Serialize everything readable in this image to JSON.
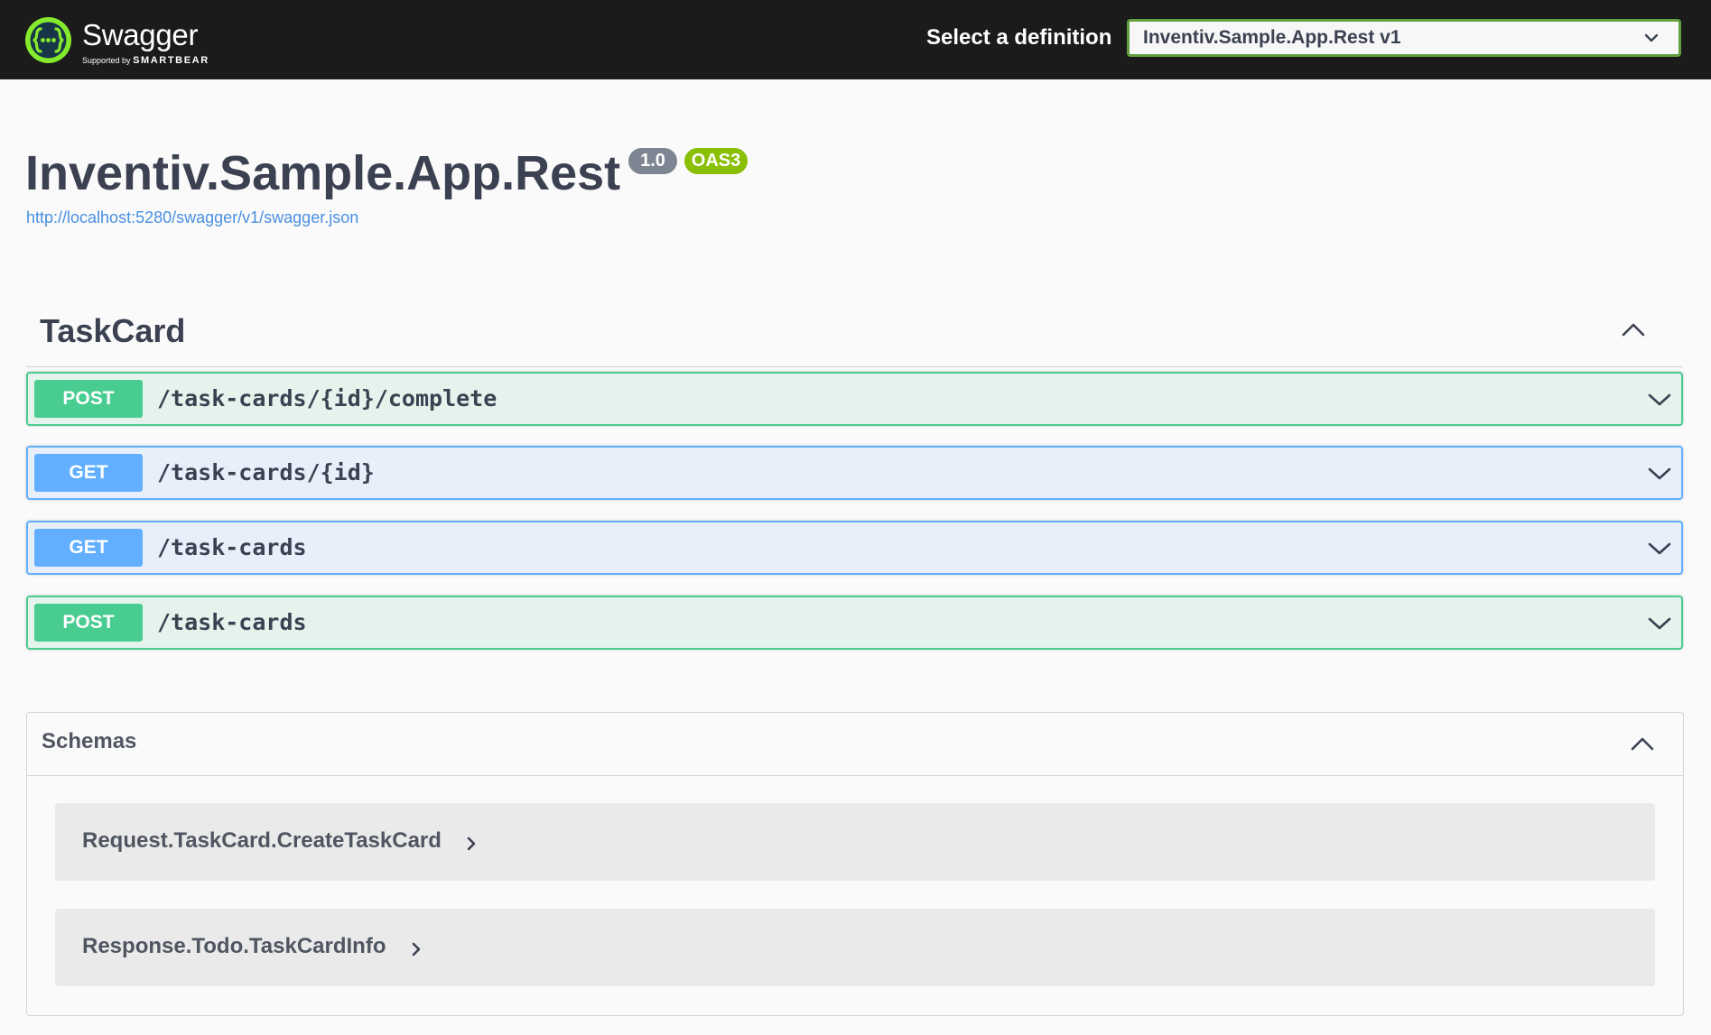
{
  "topbar": {
    "logo_name": "Swagger",
    "logo_sub_prefix": "Supported by",
    "logo_sub_brand": "SMARTBEAR",
    "definition_label": "Select a definition",
    "definition_value": "Inventiv.Sample.App.Rest v1"
  },
  "info": {
    "title": "Inventiv.Sample.App.Rest",
    "version": "1.0",
    "oas_badge": "OAS3",
    "spec_url": "http://localhost:5280/swagger/v1/swagger.json"
  },
  "tag": {
    "name": "TaskCard",
    "operations": [
      {
        "method": "POST",
        "path": "/task-cards/{id}/complete"
      },
      {
        "method": "GET",
        "path": "/task-cards/{id}"
      },
      {
        "method": "GET",
        "path": "/task-cards"
      },
      {
        "method": "POST",
        "path": "/task-cards"
      }
    ]
  },
  "schemas": {
    "title": "Schemas",
    "models": [
      {
        "name": "Request.TaskCard.CreateTaskCard"
      },
      {
        "name": "Response.Todo.TaskCardInfo"
      }
    ]
  },
  "icons": {
    "logo": "swagger-logo-icon",
    "select_chevron": "chevron-down-icon",
    "tag_collapse": "chevron-up-icon",
    "op_expand": "chevron-down-icon",
    "model_expand": "chevron-right-icon"
  },
  "colors": {
    "topbar": "#1b1b1b",
    "accent_green": "#62a03f",
    "post": "#49cc90",
    "get": "#61affe",
    "version_badge": "#7d8492",
    "oas_badge": "#89bf04",
    "link": "#4990e2"
  }
}
